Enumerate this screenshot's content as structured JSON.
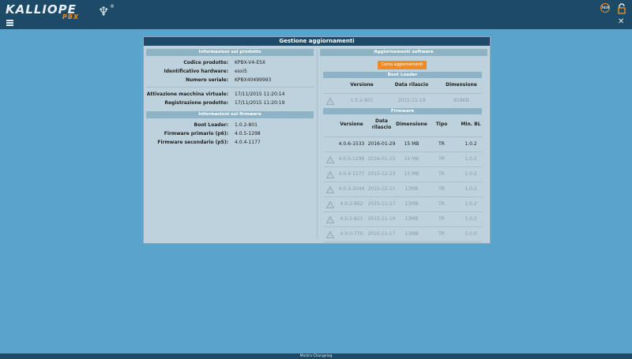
{
  "header": {
    "logo_main": "KALLIOPE",
    "logo_sub": "PBX",
    "logo_reg": "®",
    "timer_text": "7d:8"
  },
  "panel": {
    "title": "Gestione aggiornamenti"
  },
  "product_info": {
    "header": "Informazioni sul prodotto",
    "rows": [
      {
        "label": "Codice prodotto:",
        "value": "KPBX-V4-ESX"
      },
      {
        "label": "Identificativo hardware:",
        "value": "esxi5"
      },
      {
        "label": "Numero seriale:",
        "value": "KPBX40499993"
      }
    ],
    "rows2": [
      {
        "label": "Attivazione macchina virtuale:",
        "value": "17/11/2015 11:20:14"
      },
      {
        "label": "Registrazione prodotto:",
        "value": "17/11/2015 11:20:19"
      }
    ]
  },
  "firmware_info": {
    "header": "Informazioni sul firmware",
    "rows": [
      {
        "label": "Boot Loader:",
        "value": "1.0.2-801"
      },
      {
        "label": "Firmware primario (p6):",
        "value": "4.0.5-1298"
      },
      {
        "label": "Firmware secondario (p5):",
        "value": "4.0.4-1177"
      }
    ]
  },
  "software_updates": {
    "header": "Aggiornamenti software",
    "check_button": "Cerca aggiornamenti",
    "bootloader": {
      "header": "Boot Loader",
      "columns": [
        "Versione",
        "Data rilascio",
        "Dimensione"
      ],
      "rows": [
        {
          "version": "1.0.2-801",
          "date": "2015-11-19",
          "size": "818KB",
          "warn": true
        }
      ]
    },
    "firmware": {
      "header": "Firmware",
      "columns": [
        "Versione",
        "Data rilascio",
        "Dimensione",
        "Tipo",
        "Min. BL"
      ],
      "rows": [
        {
          "version": "4.0.6-1533",
          "date": "2016-01-29",
          "size": "15 MB",
          "type": "TR",
          "min_bl": "1.0.2",
          "warn": false
        },
        {
          "version": "4.0.5-1298",
          "date": "2016-01-15",
          "size": "15 MB",
          "type": "TR",
          "min_bl": "1.0.2",
          "warn": true
        },
        {
          "version": "4.0.4-1177",
          "date": "2015-12-23",
          "size": "15 MB",
          "type": "TR",
          "min_bl": "1.0.2",
          "warn": true
        },
        {
          "version": "4.0.3-1044",
          "date": "2015-12-11",
          "size": "13MB",
          "type": "TR",
          "min_bl": "1.0.2",
          "warn": true
        },
        {
          "version": "4.0.2-862",
          "date": "2015-11-27",
          "size": "13MB",
          "type": "TR",
          "min_bl": "1.0.2",
          "warn": true
        },
        {
          "version": "4.0.1-821",
          "date": "2015-11-19",
          "size": "13MB",
          "type": "TR",
          "min_bl": "1.0.2",
          "warn": true
        },
        {
          "version": "4.0.0-770",
          "date": "2015-11-17",
          "size": "13MB",
          "type": "TR",
          "min_bl": "1.0.0",
          "warn": true
        }
      ]
    }
  },
  "footer": {
    "changelog_label": "Mostra Changelog"
  },
  "colors": {
    "topbar": "#1d4a66",
    "background": "#5aa3cc",
    "accent": "#f08a24",
    "panel": "#bdd2dc"
  }
}
